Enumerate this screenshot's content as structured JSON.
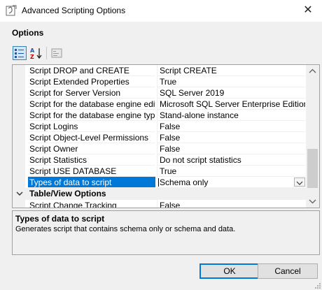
{
  "window": {
    "title": "Advanced Scripting Options",
    "close_glyph": "✕"
  },
  "options": {
    "label": "Options"
  },
  "toolbar": {
    "categorized_icon": "categorized-view-icon",
    "alphabetical_icon": "sort-alphabetical-icon",
    "property_pages_icon": "property-pages-icon"
  },
  "grid": {
    "rows": [
      {
        "name": "Script DROP and CREATE",
        "value": "Script CREATE"
      },
      {
        "name": "Script Extended Properties",
        "value": "True"
      },
      {
        "name": "Script for Server Version",
        "value": "SQL Server 2019"
      },
      {
        "name": "Script for the database engine edition",
        "value": "Microsoft SQL Server Enterprise Edition"
      },
      {
        "name": "Script for the database engine type",
        "value": "Stand-alone instance"
      },
      {
        "name": "Script Logins",
        "value": "False"
      },
      {
        "name": "Script Object-Level Permissions",
        "value": "False"
      },
      {
        "name": "Script Owner",
        "value": "False"
      },
      {
        "name": "Script Statistics",
        "value": "Do not script statistics"
      },
      {
        "name": "Script USE DATABASE",
        "value": "True"
      },
      {
        "name": "Types of data to script",
        "value": "Schema only"
      }
    ],
    "category": {
      "label": "Table/View Options"
    },
    "after_category_rows": [
      {
        "name": "Script Change Tracking",
        "value": "False"
      }
    ]
  },
  "description": {
    "title": "Types of data to script",
    "text": "Generates script that contains schema only or schema and data."
  },
  "buttons": {
    "ok": "OK",
    "cancel": "Cancel"
  },
  "colors": {
    "selection": "#0078d7",
    "dialog_bg": "#f0f0f0",
    "border": "#a0a0a0"
  }
}
